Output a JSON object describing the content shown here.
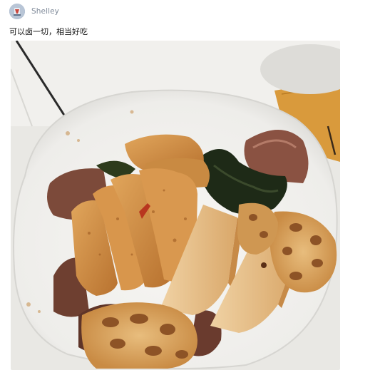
{
  "post": {
    "author": {
      "name": "Shelley",
      "avatar_icon": "avatar-icon"
    },
    "caption": "可以卤一切，相当好吃",
    "image": {
      "kind": "food-photo"
    }
  },
  "colors": {
    "username": "#7f8a99",
    "caption": "#111111",
    "table": "#ecebe7",
    "plate": "#f5f4f1",
    "board": "#d99a3c",
    "tofu": "#d28f49",
    "lotus": "#d8a35e",
    "meat": "#7c4a3a",
    "kelp": "#1e2a17"
  }
}
